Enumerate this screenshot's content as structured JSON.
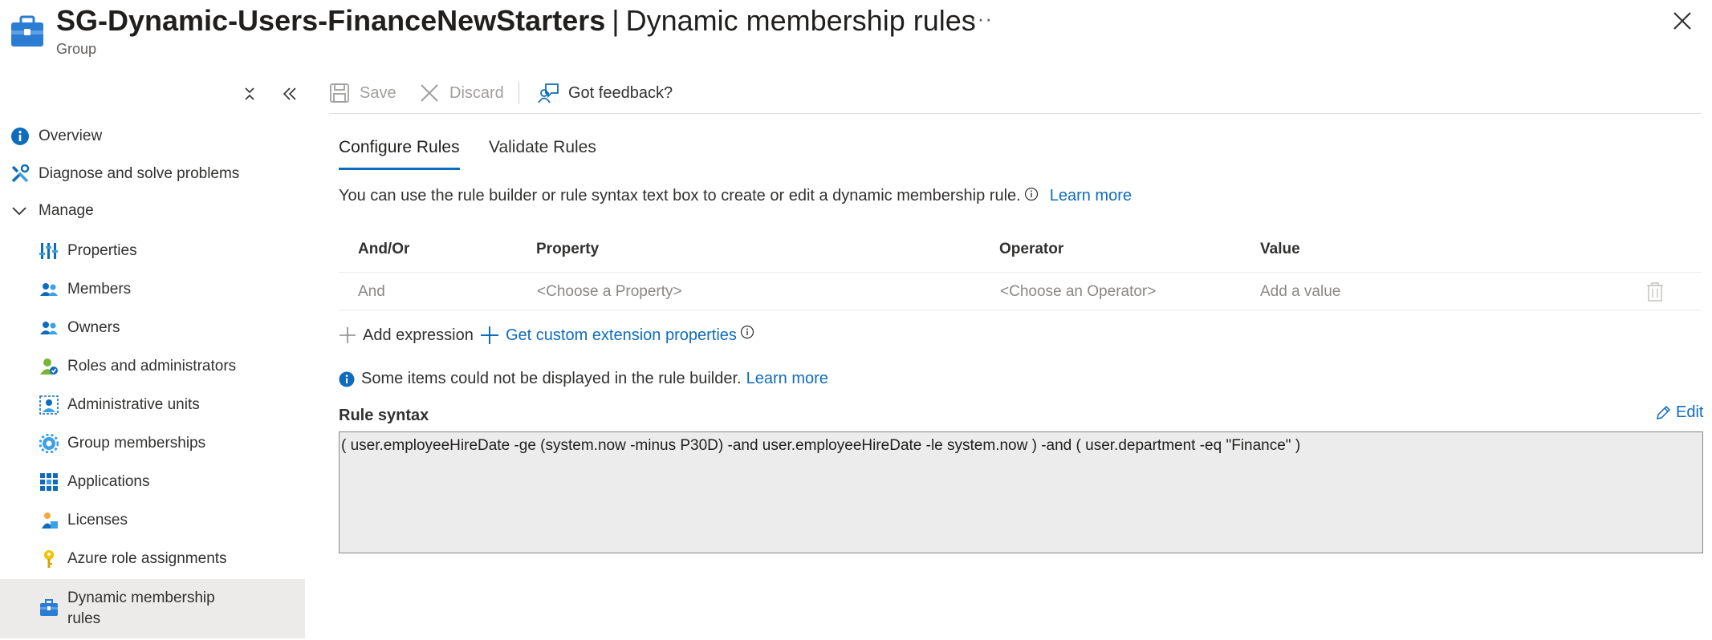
{
  "header": {
    "group_name": "SG-Dynamic-Users-FinanceNewStarters",
    "separator": "|",
    "page_title": "Dynamic membership rules",
    "subtitle": "Group",
    "more_label": "···",
    "icon": "group-icon"
  },
  "sidebar": {
    "items": [
      {
        "label": "Overview",
        "icon": "info-icon"
      },
      {
        "label": "Diagnose and solve problems",
        "icon": "wrench-icon"
      },
      {
        "label": "Manage",
        "icon": "chevron-down-icon"
      },
      {
        "label": "Properties",
        "icon": "properties-icon"
      },
      {
        "label": "Members",
        "icon": "members-icon"
      },
      {
        "label": "Owners",
        "icon": "owners-icon"
      },
      {
        "label": "Roles and administrators",
        "icon": "roles-icon"
      },
      {
        "label": "Administrative units",
        "icon": "admin-units-icon"
      },
      {
        "label": "Group memberships",
        "icon": "gear-icon"
      },
      {
        "label": "Applications",
        "icon": "apps-grid-icon"
      },
      {
        "label": "Licenses",
        "icon": "license-icon"
      },
      {
        "label": "Azure role assignments",
        "icon": "key-icon"
      },
      {
        "label": "Dynamic membership rules",
        "icon": "group-icon",
        "active": true
      }
    ]
  },
  "toolbar": {
    "save_label": "Save",
    "discard_label": "Discard",
    "feedback_label": "Got feedback?"
  },
  "tabs": [
    {
      "label": "Configure Rules",
      "active": true
    },
    {
      "label": "Validate Rules",
      "active": false
    }
  ],
  "description": {
    "text": "You can use the rule builder or rule syntax text box to create or edit a dynamic membership rule.",
    "link": "Learn more"
  },
  "grid": {
    "headers": [
      "And/Or",
      "Property",
      "Operator",
      "Value"
    ],
    "row": {
      "and_or": "And",
      "property_placeholder": "<Choose a Property>",
      "operator_placeholder": "<Choose an Operator>",
      "value_placeholder": "Add a value"
    }
  },
  "actions": {
    "add_expression": "Add expression",
    "custom_extension": "Get custom extension properties"
  },
  "notice": {
    "text": "Some items could not be displayed in the rule builder.",
    "link": "Learn more"
  },
  "rule_syntax": {
    "label": "Rule syntax",
    "edit_label": "Edit",
    "value": "( user.employeeHireDate -ge (system.now -minus P30D) -and user.employeeHireDate -le system.now ) -and ( user.department -eq \"Finance\" )"
  },
  "colors": {
    "accent": "#0f6cbd",
    "active_nav_bg": "#edebe9",
    "syntax_bg": "#ececec"
  }
}
